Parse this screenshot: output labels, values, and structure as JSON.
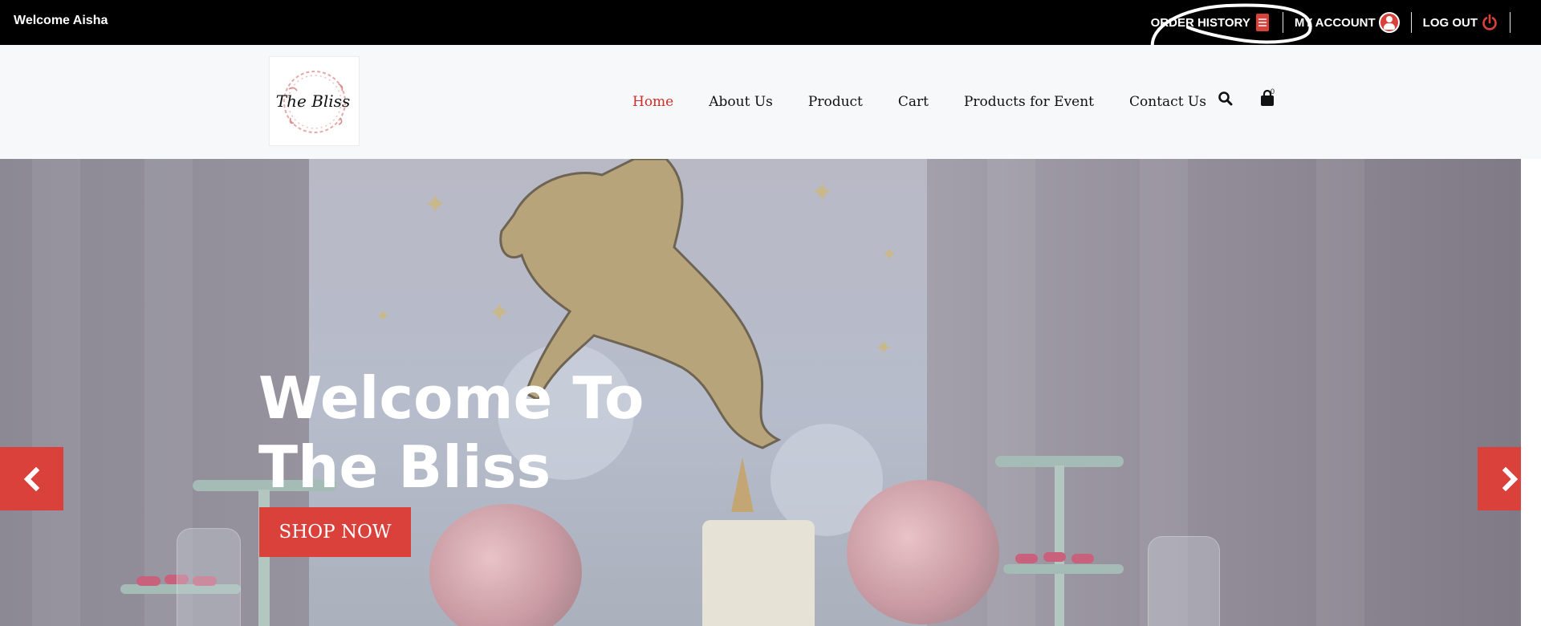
{
  "topbar": {
    "welcome": "Welcome Aisha",
    "links": {
      "order_history": "ORDER HISTORY",
      "my_account": "MY ACCOUNT",
      "log_out": "LOG OUT"
    },
    "icons": {
      "order_history": "document-icon",
      "my_account": "user-circle-icon",
      "log_out": "power-icon"
    }
  },
  "logo": {
    "text": "The Bliss"
  },
  "nav": {
    "items": [
      "Home",
      "About Us",
      "Product",
      "Cart",
      "Products for Event",
      "Contact Us"
    ],
    "active": "Home",
    "icons": [
      "search-icon",
      "shopping-bag-icon"
    ],
    "cart_count": "0"
  },
  "hero": {
    "title_line1": "Welcome To",
    "title_line2": "The Bliss",
    "button": "SHOP NOW",
    "prev_icon": "chevron-left-icon",
    "next_icon": "chevron-right-icon"
  },
  "colors": {
    "accent": "#d9413a",
    "topbar_bg": "#000000",
    "header_bg": "#f7f8f9",
    "active_nav": "#c9302c"
  }
}
